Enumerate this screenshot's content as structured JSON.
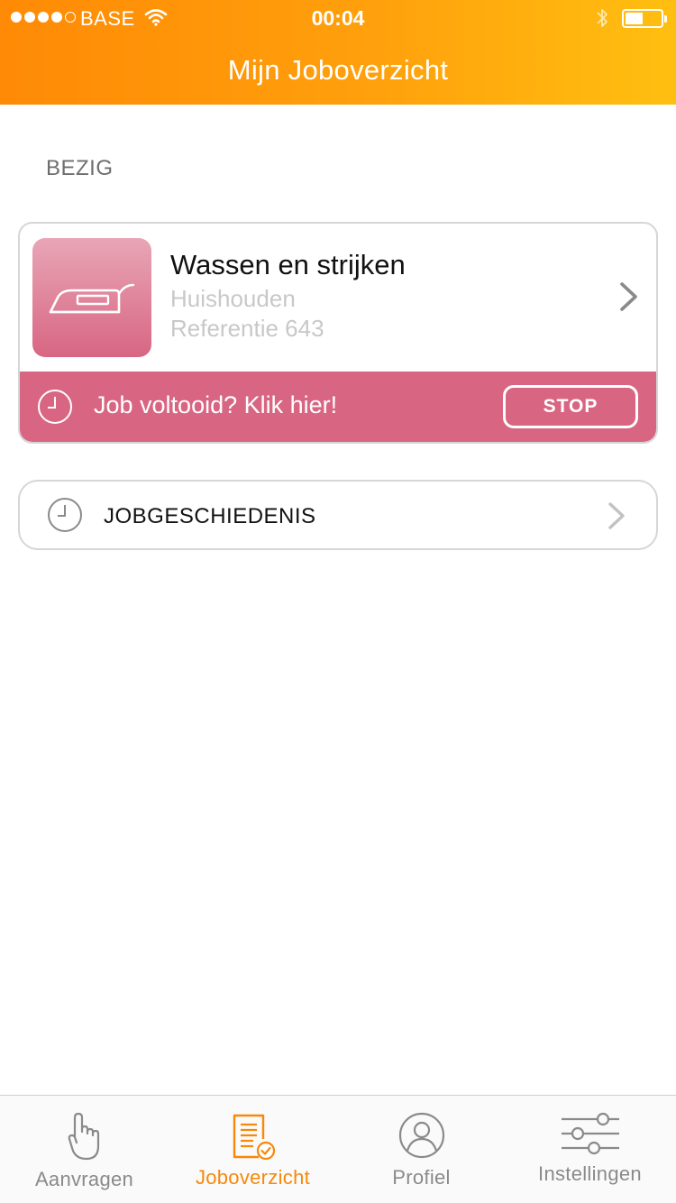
{
  "status_bar": {
    "carrier": "BASE",
    "time": "00:04",
    "signal_bars_filled": 4,
    "signal_bars_total": 5,
    "battery_level": 0.5
  },
  "nav": {
    "title": "Mijn Joboverzicht"
  },
  "active_section": {
    "label": "BEZIG",
    "job": {
      "icon": "iron-icon",
      "title": "Wassen en strijken",
      "category": "Huishouden",
      "reference": "Referentie 643",
      "prompt": "Job voltooid? Klik hier!",
      "stop_label": "STOP"
    }
  },
  "history": {
    "label": "JOBGESCHIEDENIS"
  },
  "tabs": [
    {
      "label": "Aanvragen",
      "icon": "pointing-hand-icon",
      "active": false
    },
    {
      "label": "Joboverzicht",
      "icon": "document-check-icon",
      "active": true
    },
    {
      "label": "Profiel",
      "icon": "user-icon",
      "active": false
    },
    {
      "label": "Instellingen",
      "icon": "sliders-icon",
      "active": false
    }
  ],
  "colors": {
    "header_gradient_start": "#ff8a05",
    "header_gradient_end": "#ffbf10",
    "job_accent": "#d86683",
    "tab_active": "#f7880a",
    "tab_inactive": "#8a8a8a"
  }
}
